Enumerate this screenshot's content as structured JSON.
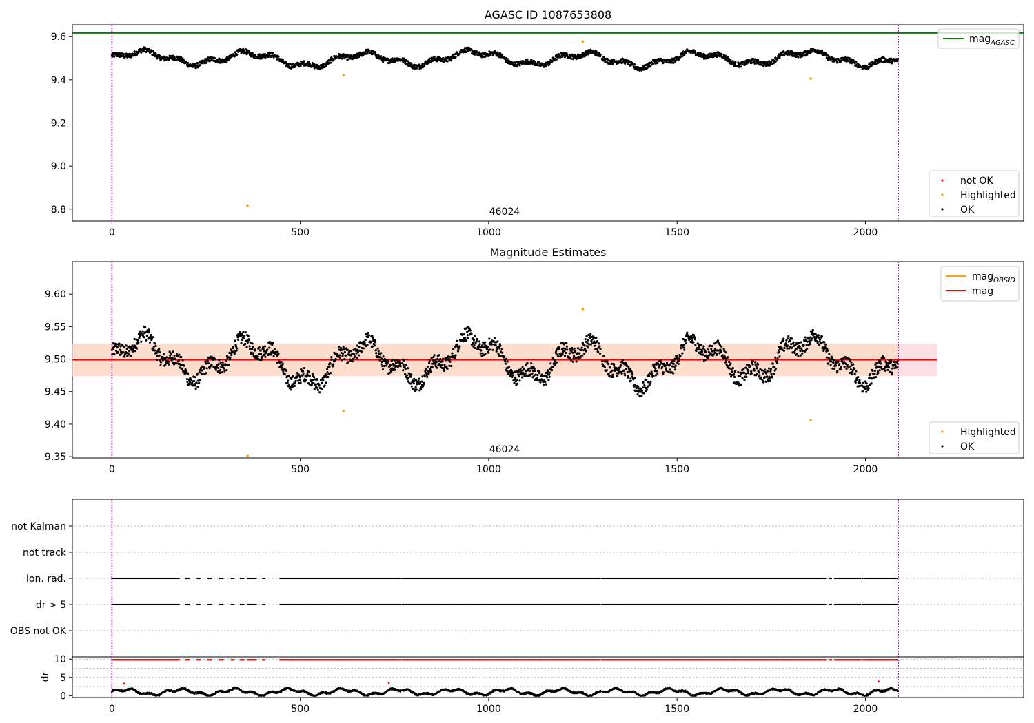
{
  "colors": {
    "ok": "#000000",
    "highlighted": "#ffa500",
    "not_ok": "#ff0000",
    "agasc_line": "#008000",
    "mag_line": "#ff0000",
    "obsid_line": "#ffa500",
    "band_mag": "#ffc0cb",
    "band_obsid": "#ffdab9",
    "obs_boundary": "#800080"
  },
  "obsid": "46024",
  "x_ticks": [
    "0",
    "500",
    "1000",
    "1500",
    "2000"
  ],
  "chart_data": [
    {
      "type": "scatter",
      "title": "AGASC ID 1087653808",
      "xlim": [
        -105,
        2420
      ],
      "ylim": [
        8.745,
        9.655
      ],
      "y_ticks": [
        "9.6",
        "9.4",
        "9.2",
        "9.0",
        "8.8"
      ],
      "y_tick_values": [
        9.6,
        9.4,
        9.2,
        9.0,
        8.8
      ],
      "hline": {
        "name": "mag_AGASC",
        "value": 9.617,
        "x_end": 2420
      },
      "obs_bounds": [
        0,
        2087
      ],
      "obs_label": "46024",
      "series": [
        {
          "name": "OK",
          "generator": "mag",
          "base": 9.497,
          "amplitude": 0.045
        },
        {
          "name": "Highlighted",
          "points": [
            [
              360,
              8.817
            ],
            [
              615,
              9.421
            ],
            [
              1250,
              9.577
            ],
            [
              1855,
              9.406
            ]
          ]
        }
      ],
      "legends": [
        {
          "position": "top-right",
          "items": [
            {
              "kind": "line",
              "label": "mag",
              "sub": "AGASC",
              "color": "#008000"
            }
          ]
        },
        {
          "position": "bottom-right",
          "items": [
            {
              "kind": "dot",
              "label": "not OK",
              "color": "#ff0000"
            },
            {
              "kind": "dot",
              "label": "Highlighted",
              "color": "#ffa500"
            },
            {
              "kind": "dot",
              "label": "OK",
              "color": "#000000"
            }
          ]
        }
      ]
    },
    {
      "type": "scatter",
      "title": "Magnitude Estimates",
      "xlim": [
        -105,
        2420
      ],
      "ylim": [
        9.348,
        9.65
      ],
      "y_ticks": [
        "9.60",
        "9.55",
        "9.50",
        "9.45",
        "9.40",
        "9.35"
      ],
      "y_tick_values": [
        9.6,
        9.55,
        9.5,
        9.45,
        9.4,
        9.35
      ],
      "hline_mag": {
        "name": "mag",
        "value": 9.499,
        "band": [
          9.474,
          9.524
        ],
        "x_end": 2190
      },
      "hline_obsid": {
        "name": "mag_OBSID",
        "value": 9.499,
        "band": [
          9.474,
          9.524
        ],
        "x_range": [
          0,
          2087
        ]
      },
      "obs_bounds": [
        0,
        2087
      ],
      "obs_label": "46024",
      "series": [
        {
          "name": "OK",
          "generator": "mag",
          "base": 9.497,
          "amplitude": 0.045
        },
        {
          "name": "Highlighted",
          "points": [
            [
              360,
              9.351
            ],
            [
              615,
              9.42
            ],
            [
              1250,
              9.577
            ],
            [
              1855,
              9.406
            ]
          ]
        }
      ],
      "legends": [
        {
          "position": "top-right",
          "items": [
            {
              "kind": "line",
              "label": "mag",
              "sub": "OBSID",
              "color": "#ffa500"
            },
            {
              "kind": "line",
              "label": "mag",
              "color": "#ff0000"
            }
          ]
        },
        {
          "position": "bottom-right",
          "items": [
            {
              "kind": "dot",
              "label": "Highlighted",
              "color": "#ffa500"
            },
            {
              "kind": "dot",
              "label": "OK",
              "color": "#000000"
            }
          ]
        }
      ]
    },
    {
      "type": "scatter",
      "title": "",
      "xlim": [
        -105,
        2420
      ],
      "categories": [
        "not Kalman",
        "not track",
        "Ion. rad.",
        "dr > 5",
        "OBS not OK"
      ],
      "flag_rows": [
        "Ion. rad.",
        "dr > 5"
      ],
      "obs_bounds": [
        0,
        2087
      ]
    },
    {
      "type": "scatter",
      "title": "",
      "ylabel": "dr",
      "xlim": [
        -105,
        2420
      ],
      "ylim": [
        -0.5,
        10.6
      ],
      "y_ticks": [
        "10",
        "5",
        "0"
      ],
      "y_tick_values": [
        10,
        5,
        0
      ],
      "obs_bounds": [
        0,
        2087
      ],
      "series": [
        {
          "name": "dr",
          "generator": "dr",
          "base": 1.0
        },
        {
          "name": "dr > 5",
          "generator": "flag",
          "value": 9.8
        },
        {
          "name": "not OK",
          "points": [
            [
              32,
              3.3
            ],
            [
              735,
              3.5
            ],
            [
              2035,
              3.9
            ]
          ]
        }
      ]
    }
  ]
}
